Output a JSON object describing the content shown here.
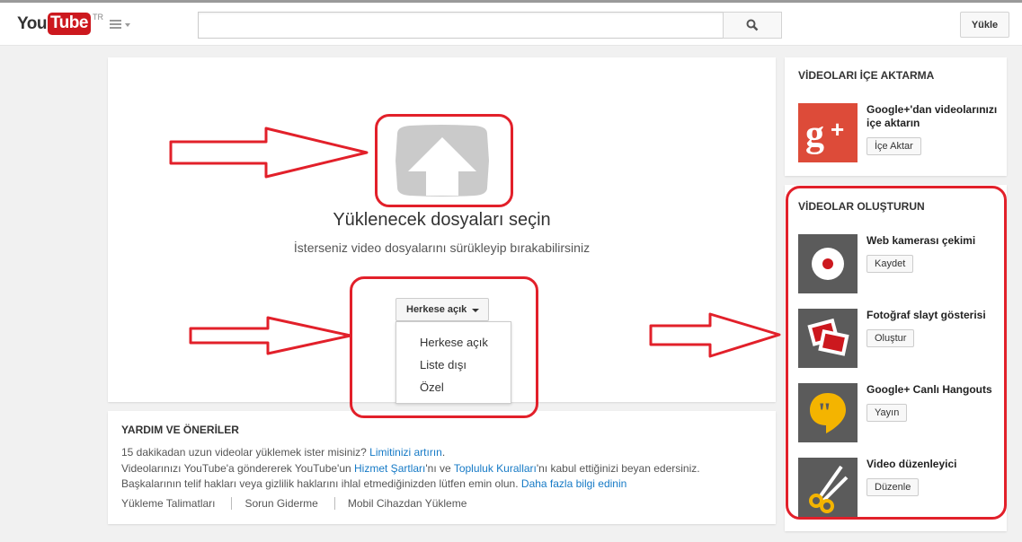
{
  "header": {
    "logo_you": "You",
    "logo_tube": "Tube",
    "logo_region": "TR",
    "search_value": "",
    "upload_label": "Yükle"
  },
  "main": {
    "title": "Yüklenecek dosyaları seçin",
    "subtitle": "İsterseniz video dosyalarını sürükleyip bırakabilirsiniz",
    "privacy_selected": "Herkese açık",
    "privacy_options": [
      "Herkese açık",
      "Liste dışı",
      "Özel"
    ]
  },
  "help": {
    "title": "YARDIM VE ÖNERİLER",
    "line1_text": "15 dakikadan uzun videolar yüklemek ister misiniz? ",
    "line1_link": "Limitinizi artırın",
    "line1_end": ".",
    "line2_pre": "Videolarınızı YouTube'a göndererek YouTube'un ",
    "line2_link1": "Hizmet Şartları",
    "line2_mid": "'nı ve ",
    "line2_link2": "Topluluk Kuralları",
    "line2_end": "'nı kabul ettiğinizi beyan edersiniz.",
    "line3_pre": "Başkalarının telif hakları veya gizlilik haklarını ihlal etmediğinizden lütfen emin olun. ",
    "line3_link": "Daha fazla bilgi edinin",
    "links": [
      "Yükleme Talimatları",
      "Sorun Giderme",
      "Mobil Cihazdan Yükleme"
    ]
  },
  "import": {
    "title": "VİDEOLARI İÇE AKTARMA",
    "item_label": "Google+'dan videolarınızı içe aktarın",
    "item_button": "İçe Aktar"
  },
  "create": {
    "title": "VİDEOLAR OLUŞTURUN",
    "items": [
      {
        "label": "Web kamerası çekimi",
        "button": "Kaydet",
        "icon": "webcam-record-icon"
      },
      {
        "label": "Fotoğraf slayt gösterisi",
        "button": "Oluştur",
        "icon": "photo-slideshow-icon"
      },
      {
        "label": "Google+ Canlı Hangouts",
        "button": "Yayın",
        "icon": "hangouts-icon"
      },
      {
        "label": "Video düzenleyici",
        "button": "Düzenle",
        "icon": "scissors-icon"
      }
    ]
  },
  "colors": {
    "brand_red": "#cc181e",
    "annotation_red": "#e2202a",
    "link_blue": "#167ac6",
    "gplus_red": "#dd4b39",
    "hangouts_green": "#0f9d58"
  }
}
